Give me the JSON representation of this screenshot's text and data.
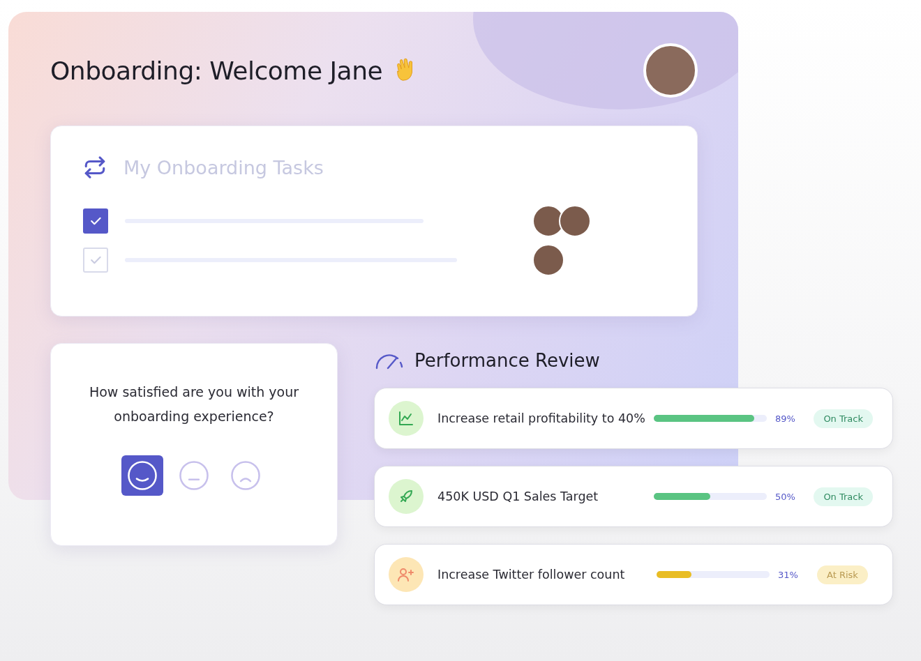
{
  "header": {
    "title": "Onboarding: Welcome Jane"
  },
  "tasks": {
    "title": "My Onboarding Tasks",
    "items": [
      {
        "checked": true,
        "avatars": [
          {
            "kind": "photo"
          },
          {
            "kind": "photo"
          }
        ]
      },
      {
        "checked": false,
        "avatars": [
          {
            "kind": "photo"
          }
        ]
      }
    ]
  },
  "survey": {
    "question": "How satisfied are you with your onboarding experience?",
    "options": [
      {
        "kind": "happy",
        "selected": true
      },
      {
        "kind": "neutral",
        "selected": false
      },
      {
        "kind": "sad",
        "selected": false
      }
    ]
  },
  "performance": {
    "title": "Performance Review",
    "goals": [
      {
        "kind": "chart",
        "label": "Increase retail profitability to 40%",
        "level": 0.89,
        "reading": "89%",
        "status": {
          "kind": "on_track",
          "label": "On Track"
        }
      },
      {
        "kind": "rocket",
        "label": "450K USD Q1 Sales Target",
        "level": 0.5,
        "reading": "50%",
        "status": {
          "kind": "on_track",
          "label": "On Track"
        }
      },
      {
        "kind": "user_add",
        "label": "Increase Twitter follower count",
        "level": 0.31,
        "reading": "31%",
        "status": {
          "kind": "at_risk",
          "label": "At Risk"
        }
      }
    ]
  }
}
